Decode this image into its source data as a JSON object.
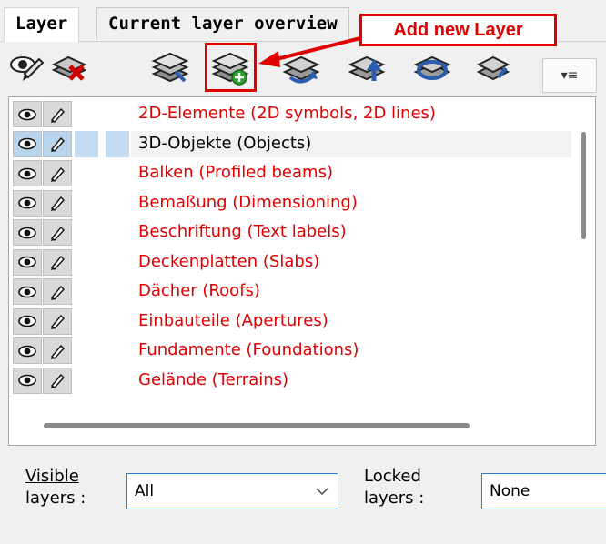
{
  "tabs": [
    {
      "label": "Layer",
      "active": true
    },
    {
      "label": "Current layer overview",
      "active": false
    }
  ],
  "annotation": {
    "text": "Add new Layer",
    "color": "#e00000"
  },
  "toolbar": {
    "buttons": [
      {
        "icon": "visibility-toggle-icon"
      },
      {
        "icon": "delete-layer-icon"
      },
      {
        "icon": "layer-properties-icon"
      },
      {
        "icon": "add-layer-icon"
      },
      {
        "icon": "rotate-layer-icon"
      },
      {
        "icon": "move-layer-up-icon"
      },
      {
        "icon": "refresh-layer-icon"
      },
      {
        "icon": "more-tools-icon"
      }
    ],
    "menu_icon": "▾≡"
  },
  "colors": {
    "layer_text": "#e00000",
    "selected_text": "#000000",
    "selection": "#c4dcf2"
  },
  "layers": [
    {
      "name": "2D-Elemente (2D symbols, 2D lines)",
      "selected": false
    },
    {
      "name": "3D-Objekte (Objects)",
      "selected": true
    },
    {
      "name": "Balken (Profiled beams)",
      "selected": false
    },
    {
      "name": "Bemaßung (Dimensioning)",
      "selected": false
    },
    {
      "name": "Beschriftung (Text labels)",
      "selected": false
    },
    {
      "name": "Deckenplatten (Slabs)",
      "selected": false
    },
    {
      "name": "Dächer (Roofs)",
      "selected": false
    },
    {
      "name": "Einbauteile (Apertures)",
      "selected": false
    },
    {
      "name": "Fundamente (Foundations)",
      "selected": false
    },
    {
      "name": "Gelände (Terrains)",
      "selected": false
    }
  ],
  "filters": {
    "visible": {
      "label_line1": "Visible",
      "label_line2": "layers :",
      "value": "All"
    },
    "locked": {
      "label_line1": "Locked",
      "label_line2": "layers :",
      "value": "None"
    }
  }
}
